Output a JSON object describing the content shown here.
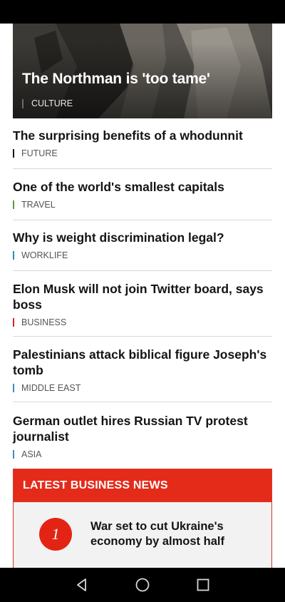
{
  "hero": {
    "title": "The Northman is 'too tame'",
    "category": "CULTURE"
  },
  "stories": [
    {
      "title": "The surprising benefits of a whodunnit",
      "category": "FUTURE",
      "accent": "#141414"
    },
    {
      "title": "One of the world's smallest capitals",
      "category": "TRAVEL",
      "accent": "#5a9b3a"
    },
    {
      "title": "Why is weight discrimination legal?",
      "category": "WORKLIFE",
      "accent": "#2a8fb0"
    },
    {
      "title": "Elon Musk will not join Twitter board, says boss",
      "category": "BUSINESS",
      "accent": "#d6261a"
    },
    {
      "title": "Palestinians attack biblical figure Joseph's tomb",
      "category": "MIDDLE EAST",
      "accent": "#3a8fc0"
    },
    {
      "title": "German outlet hires Russian TV protest journalist",
      "category": "ASIA",
      "accent": "#3a8fc0"
    }
  ],
  "business_news": {
    "heading": "LATEST BUSINESS NEWS",
    "items": [
      {
        "rank": "1",
        "title": "War set to cut Ukraine's economy by almost half"
      }
    ],
    "accent": "#e42b1a"
  },
  "nav": {
    "back_icon": "back-triangle-icon",
    "home_icon": "home-circle-icon",
    "recents_icon": "recents-square-icon"
  }
}
